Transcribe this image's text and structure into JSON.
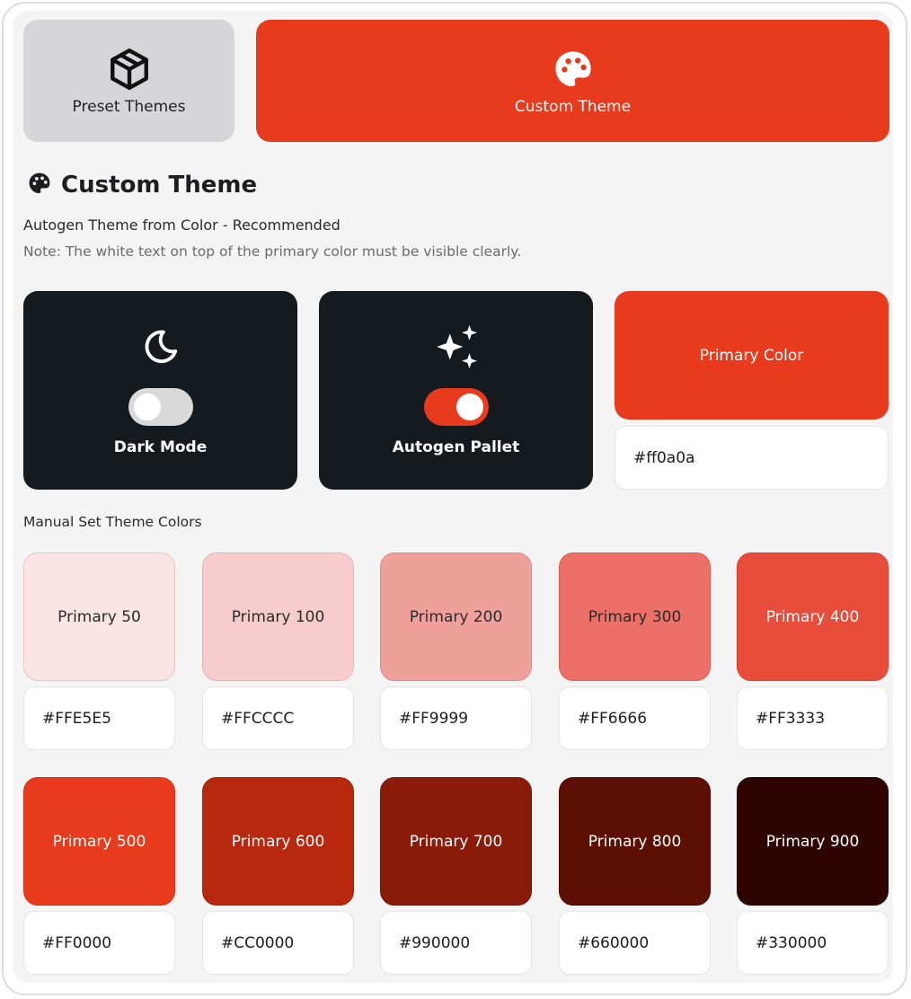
{
  "tabs": {
    "preset": {
      "label": "Preset Themes",
      "icon": "box-icon"
    },
    "custom": {
      "label": "Custom Theme",
      "icon": "palette-icon",
      "active": true
    }
  },
  "section": {
    "title": "Custom Theme",
    "icon": "palette-icon",
    "subtitle": "Autogen Theme from Color - Recommended",
    "note": "Note: The white text on top of the primary color must be visible clearly."
  },
  "cards": {
    "dark_mode": {
      "label": "Dark Mode",
      "icon": "moon-icon",
      "enabled": false
    },
    "autogen": {
      "label": "Autogen Pallet",
      "icon": "sparkles-icon",
      "enabled": true
    },
    "primary": {
      "label": "Primary Color",
      "value": "#ff0a0a"
    }
  },
  "manual": {
    "label": "Manual Set Theme Colors",
    "shades": [
      {
        "label": "Primary 50",
        "value": "#FFE5E5",
        "swatch": "#fae4e4",
        "text": "#2a2a2a",
        "border": "#ebc3c3"
      },
      {
        "label": "Primary 100",
        "value": "#FFCCCC",
        "swatch": "#f6cccc",
        "text": "#2a2a2a",
        "border": "#e6b3b3"
      },
      {
        "label": "Primary 200",
        "value": "#FF9999",
        "swatch": "#f0a09b",
        "text": "#2a2a2a",
        "border": "#df8a85"
      },
      {
        "label": "Primary 300",
        "value": "#FF6666",
        "swatch": "#ec7068",
        "text": "#2a2a2a",
        "border": "#d95e56"
      },
      {
        "label": "Primary 400",
        "value": "#FF3333",
        "swatch": "#e84d3c",
        "text": "#ffffff",
        "border": "#d83f2f"
      },
      {
        "label": "Primary 500",
        "value": "#FF0000",
        "swatch": "#e83a1c",
        "text": "#ffffff",
        "border": "#d43218"
      },
      {
        "label": "Primary 600",
        "value": "#CC0000",
        "swatch": "#b7280e",
        "text": "#ffffff",
        "border": "#a2220b"
      },
      {
        "label": "Primary 700",
        "value": "#990000",
        "swatch": "#8a1b09",
        "text": "#ffffff",
        "border": "#761607"
      },
      {
        "label": "Primary 800",
        "value": "#660000",
        "swatch": "#5c0f02",
        "text": "#ffffff",
        "border": "#4d0c01"
      },
      {
        "label": "Primary 900",
        "value": "#330000",
        "swatch": "#2e0400",
        "text": "#ffffff",
        "border": "#220300"
      }
    ]
  }
}
